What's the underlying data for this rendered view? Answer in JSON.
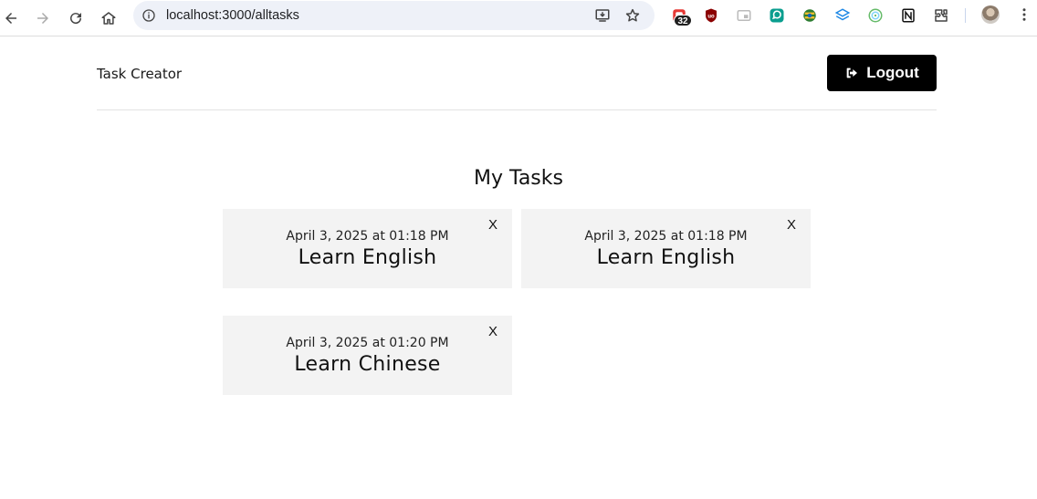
{
  "browser": {
    "url": "localhost:3000/alltasks",
    "extension_badge": "32",
    "accent": "#eef1f8"
  },
  "header": {
    "brand": "Task Creator",
    "logout_label": "Logout"
  },
  "main": {
    "title": "My Tasks",
    "close_label": "X",
    "tasks": [
      {
        "date": "April 3, 2025 at 01:18 PM",
        "name": "Learn English"
      },
      {
        "date": "April 3, 2025 at 01:18 PM",
        "name": "Learn English"
      },
      {
        "date": "April 3, 2025 at 01:20 PM",
        "name": "Learn Chinese"
      }
    ]
  },
  "icons": {
    "back": "arrow-left-icon",
    "forward": "arrow-right-icon",
    "reload": "reload-icon",
    "home": "home-icon",
    "site_info": "info-icon",
    "install": "install-app-icon",
    "bookmark": "star-icon",
    "logout": "sign-out-icon"
  },
  "colors": {
    "button_bg": "#000000",
    "card_bg": "#f3f3f3"
  }
}
